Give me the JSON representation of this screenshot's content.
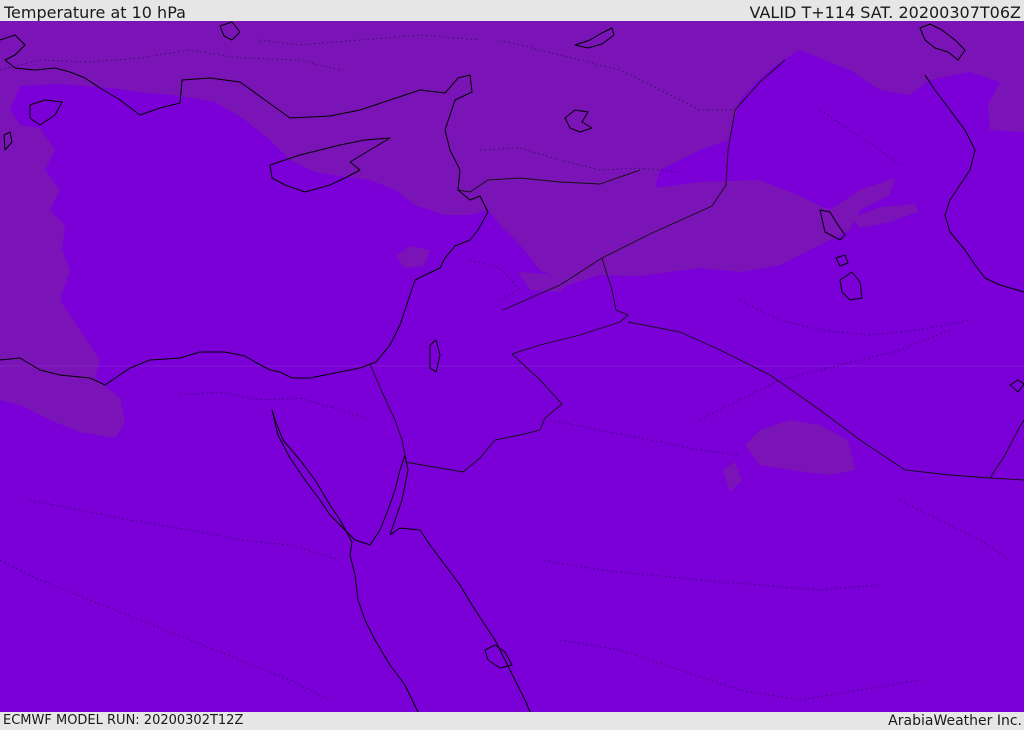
{
  "header": {
    "title": "Temperature at 10 hPa",
    "valid": "VALID T+114 SAT. 20200307T06Z"
  },
  "footer": {
    "model_run": "ECMWF MODEL RUN: 20200302T12Z",
    "credit": "ArabiaWeather Inc."
  },
  "colors": {
    "field_base": "#7b00d8",
    "field_warm": "#7a14b6",
    "coastline": "#000000",
    "bar_background": "#e6e6e6",
    "bar_text": "#1a1a1a"
  }
}
